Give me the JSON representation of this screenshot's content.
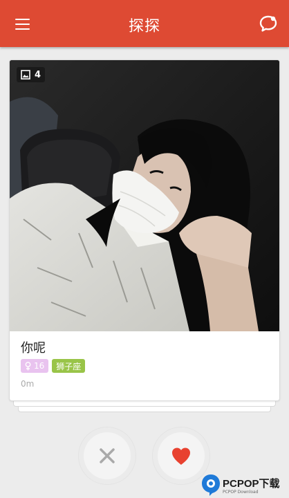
{
  "header": {
    "title": "探探",
    "menu_icon": "hamburger-menu-icon",
    "chat_icon": "chat-bubble-icon",
    "background": "#de4a33"
  },
  "card": {
    "photo_count": "4",
    "name": "你呢",
    "age": "16",
    "gender_icon": "female-icon",
    "zodiac": "狮子座",
    "distance": "0m",
    "age_tag_color": "#e9c3ef",
    "zodiac_tag_color": "#99c448"
  },
  "actions": {
    "dislike_icon": "close-x-icon",
    "like_icon": "heart-icon",
    "like_color": "#e8412f"
  },
  "watermark": {
    "text": "PCPOP下载",
    "subtext": "PCPOP Download"
  }
}
